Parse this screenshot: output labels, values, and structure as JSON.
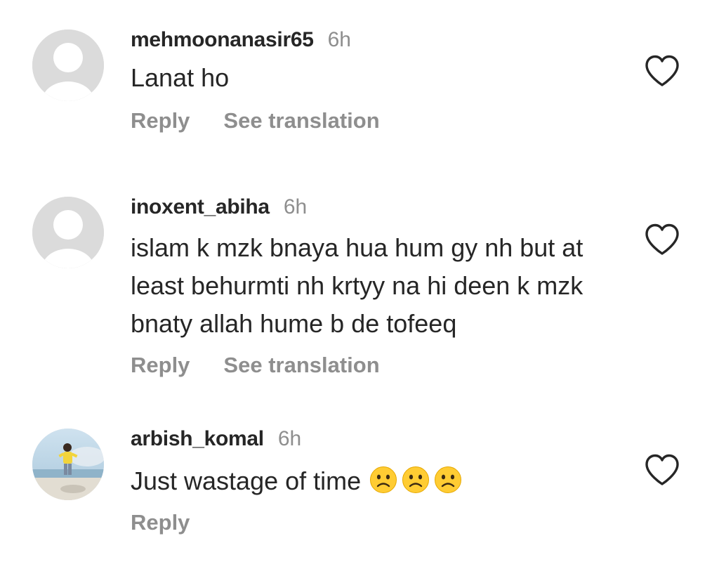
{
  "comments": [
    {
      "username": "mehmoonanasir65",
      "time": "6h",
      "text": "Lanat ho",
      "reply_label": "Reply",
      "translate_label": "See translation",
      "avatar": "default-avatar",
      "like_icon": "heart-outline-icon"
    },
    {
      "username": "inoxent_abiha",
      "time": "6h",
      "text": "islam k mzk bnaya hua hum gy nh but at least behurmti nh krtyy na hi deen k mzk bnaty allah hume b de tofeeq",
      "reply_label": "Reply",
      "translate_label": "See translation",
      "avatar": "default-avatar",
      "like_icon": "heart-outline-icon"
    },
    {
      "username": "arbish_komal",
      "time": "6h",
      "text": "Just wastage of time",
      "emojis": [
        "frowning-face",
        "frowning-face",
        "frowning-face"
      ],
      "reply_label": "Reply",
      "avatar": "photo-avatar",
      "like_icon": "heart-outline-icon"
    }
  ],
  "colors": {
    "username": "#262626",
    "text": "#262626",
    "secondary": "#8e8e8e",
    "avatar_placeholder": "#dbdbdb",
    "emoji_yellow": "#ffcc33"
  }
}
